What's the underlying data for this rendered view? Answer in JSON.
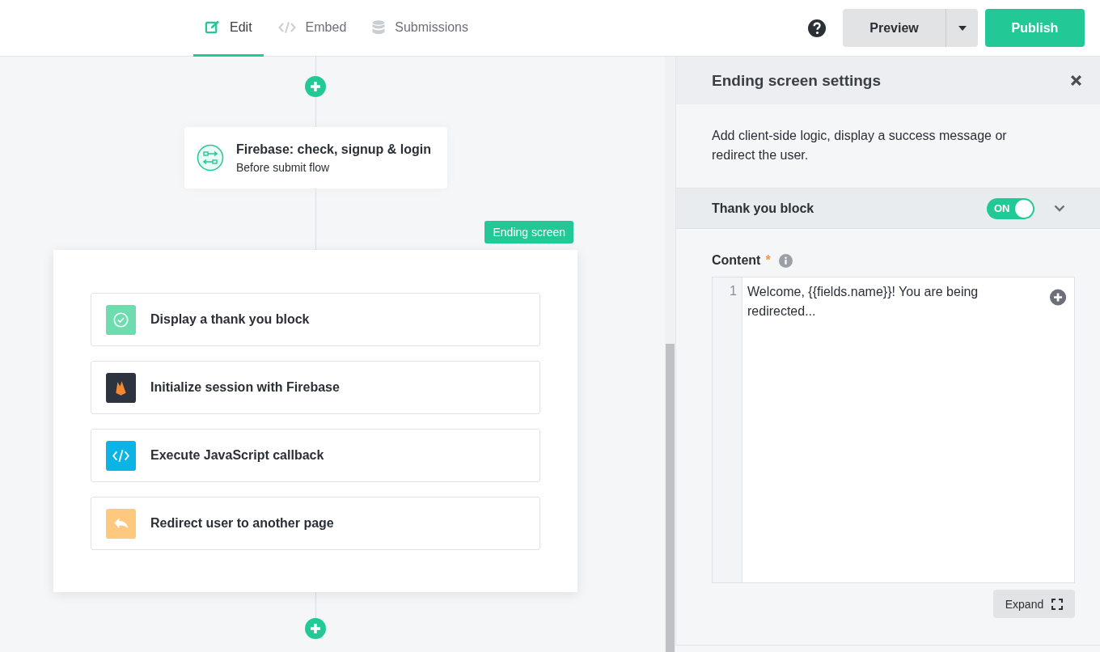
{
  "tabs": [
    {
      "label": "Edit",
      "kind": "edit",
      "selected": true
    },
    {
      "label": "Embed",
      "kind": "code",
      "selected": false
    },
    {
      "label": "Submissions",
      "kind": "database",
      "selected": false
    }
  ],
  "toolbar": {
    "preview": "Preview",
    "publish": "Publish"
  },
  "flow": {
    "step": {
      "title": "Firebase: check, signup & login",
      "subtitle": "Before submit flow"
    },
    "ending_badge": "Ending screen",
    "actions": [
      {
        "label": "Display a thank you block",
        "kind": "check",
        "color": "#6fdcb0"
      },
      {
        "label": "Initialize session with Firebase",
        "kind": "firebase",
        "color": "#2d3440"
      },
      {
        "label": "Execute JavaScript callback",
        "kind": "code",
        "color": "#0bb4e4"
      },
      {
        "label": "Redirect user to another page",
        "kind": "reply",
        "color": "#fec97e"
      }
    ]
  },
  "panel": {
    "title": "Ending screen settings",
    "description": "Add client-side logic, display a success message or redirect the user.",
    "section": {
      "title": "Thank you block",
      "toggle_label": "ON",
      "on": true,
      "expanded": true
    },
    "content_label": "Content",
    "required_mark": "*",
    "editor": {
      "line_numbers": [
        "1"
      ],
      "text": "Welcome, {{fields.name}}! You are being redirected..."
    },
    "expand_button": "Expand"
  }
}
